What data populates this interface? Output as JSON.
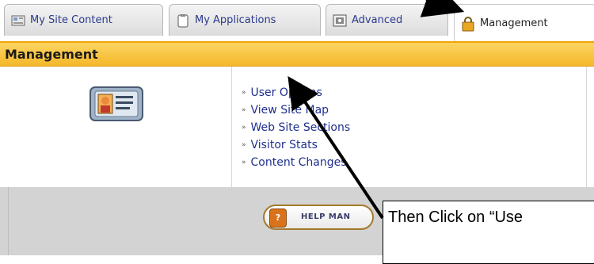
{
  "tabs": [
    {
      "label": "My Site Content",
      "icon": "site-content-icon",
      "active": false
    },
    {
      "label": "My Applications",
      "icon": "clipboard-icon",
      "active": false
    },
    {
      "label": "Advanced",
      "icon": "advanced-icon",
      "active": false
    },
    {
      "label": "Management",
      "icon": "padlock-icon",
      "active": true
    }
  ],
  "section": {
    "title": "Management"
  },
  "links": [
    {
      "label": "User Options"
    },
    {
      "label": "View Site Map"
    },
    {
      "label": "Web Site Sections"
    },
    {
      "label": "Visitor Stats"
    },
    {
      "label": "Content Changes"
    }
  ],
  "help_button": {
    "label": "HELP MAN",
    "icon": "help-book-icon"
  },
  "callout": {
    "text": "Then Click on “Use"
  },
  "colors": {
    "header": "#f5b82a",
    "link": "#1f2f8f",
    "lower_panel": "#d3d3d3"
  }
}
